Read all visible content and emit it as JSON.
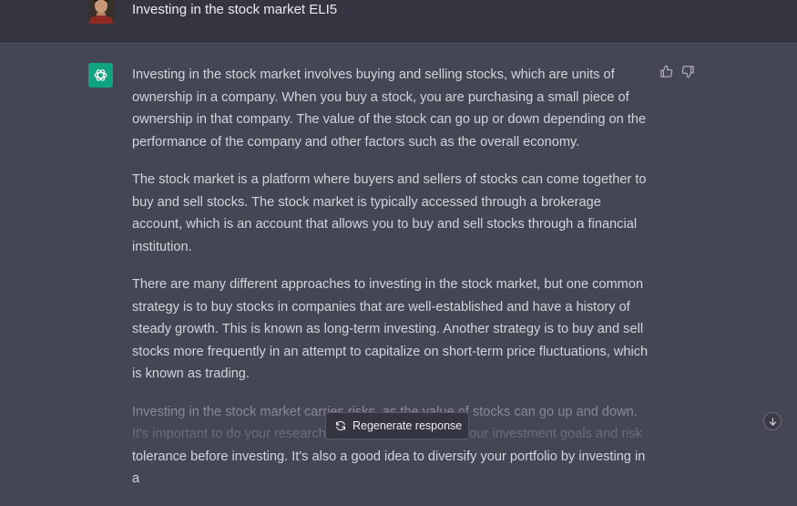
{
  "user_message": {
    "prompt": "Investing in the stock market ELI5"
  },
  "assistant_message": {
    "paragraphs": [
      "Investing in the stock market involves buying and selling stocks, which are units of ownership in a company. When you buy a stock, you are purchasing a small piece of ownership in that company. The value of the stock can go up or down depending on the performance of the company and other factors such as the overall economy.",
      "The stock market is a platform where buyers and sellers of stocks can come together to buy and sell stocks. The stock market is typically accessed through a brokerage account, which is an account that allows you to buy and sell stocks through a financial institution.",
      "There are many different approaches to investing in the stock market, but one common strategy is to buy stocks in companies that are well-established and have a history of steady growth. This is known as long-term investing. Another strategy is to buy and sell stocks more frequently in an attempt to capitalize on short-term price fluctuations, which is known as trading.",
      "Investing in the stock market carries risks, as the value of stocks can go up and down. It's important to do your research and carefully consider your investment goals and risk tolerance before investing. It's also a good idea to diversify your portfolio by investing in a"
    ]
  },
  "controls": {
    "regenerate_label": "Regenerate response"
  },
  "icons": {
    "thumbs_up": "thumbs-up-icon",
    "thumbs_down": "thumbs-down-icon",
    "regenerate": "refresh-icon",
    "scroll_down": "arrow-down-icon",
    "gpt_logo": "openai-logo-icon"
  },
  "colors": {
    "user_row_bg": "#343541",
    "assistant_row_bg": "#444654",
    "gpt_avatar_bg": "#10a37f",
    "text": "#d1d5db"
  }
}
